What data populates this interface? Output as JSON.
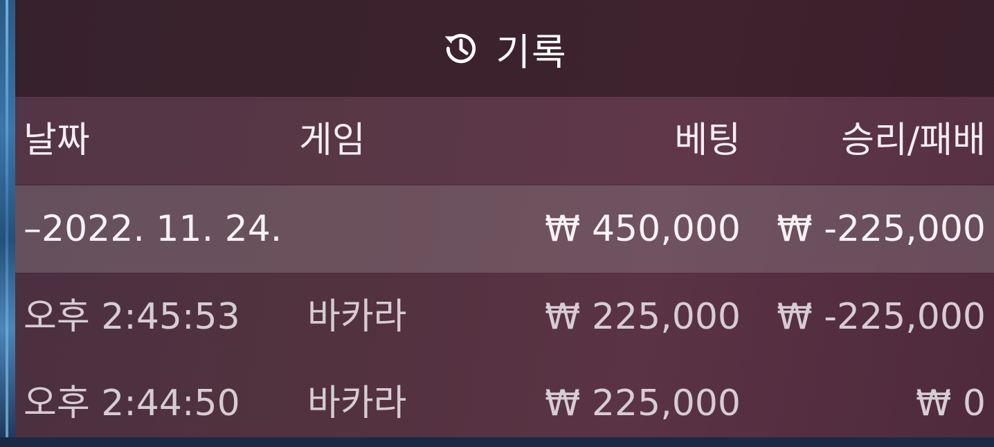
{
  "header": {
    "title": "기록",
    "icon": "history-icon"
  },
  "columns": {
    "date": "날짜",
    "game": "게임",
    "bet": "베팅",
    "win_loss": "승리/패배"
  },
  "date_group": {
    "date": "–2022. 11. 24.",
    "bet_total": "₩ 450,000",
    "win_loss_total": "₩ -225,000"
  },
  "rows": [
    {
      "time": "오후 2:45:53",
      "game": "바카라",
      "bet": "₩ 225,000",
      "win_loss": "₩ -225,000"
    },
    {
      "time": "오후 2:44:50",
      "game": "바카라",
      "bet": "₩ 225,000",
      "win_loss": "₩ 0"
    }
  ],
  "colors": {
    "panel": "#52323f",
    "header_bg": "#2e1a24",
    "highlight_row": "#5e4a54",
    "text_primary": "#ffffff",
    "text_secondary": "#d6cdd3"
  }
}
